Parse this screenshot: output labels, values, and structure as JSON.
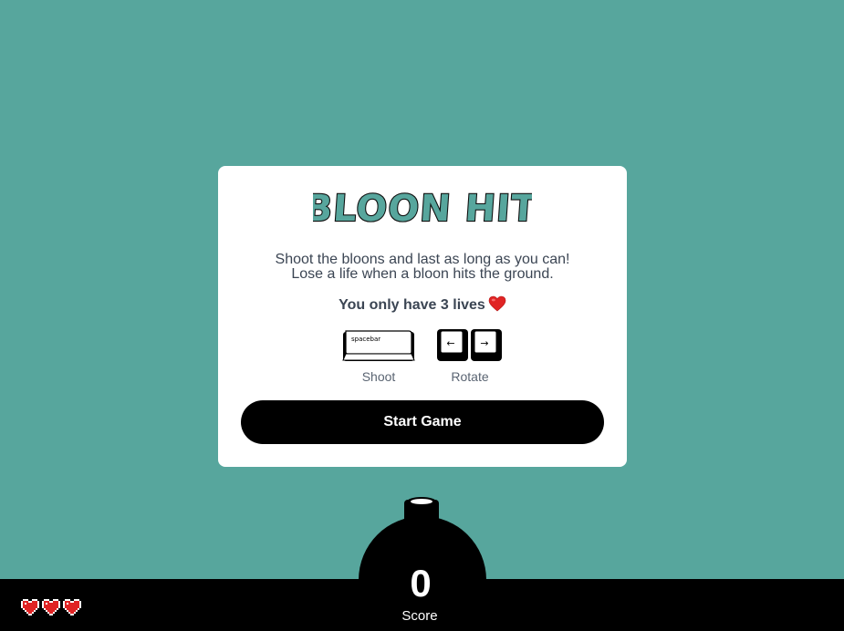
{
  "game": {
    "title": "BLOON HIT",
    "description_line1": "Shoot the bloons and last as long as you can!",
    "description_line2": "Lose a life when a bloon hits the ground.",
    "lives_text": "You only have 3 lives",
    "lives_icon": "heart-emoji"
  },
  "controls": [
    {
      "key_label": "spacebar",
      "action": "Shoot",
      "icon": "spacebar-key-icon"
    },
    {
      "key_labels": [
        "←",
        "→"
      ],
      "action": "Rotate",
      "icon": "arrow-keys-icon"
    }
  ],
  "start_button": {
    "label": "Start Game"
  },
  "hud": {
    "score_value": "0",
    "score_label": "Score",
    "lives_remaining": 3,
    "life_icon": "pixel-heart-icon"
  },
  "colors": {
    "background": "#57a69d",
    "title": "#57a69d",
    "bar": "#000000",
    "heart": "#e02424"
  }
}
